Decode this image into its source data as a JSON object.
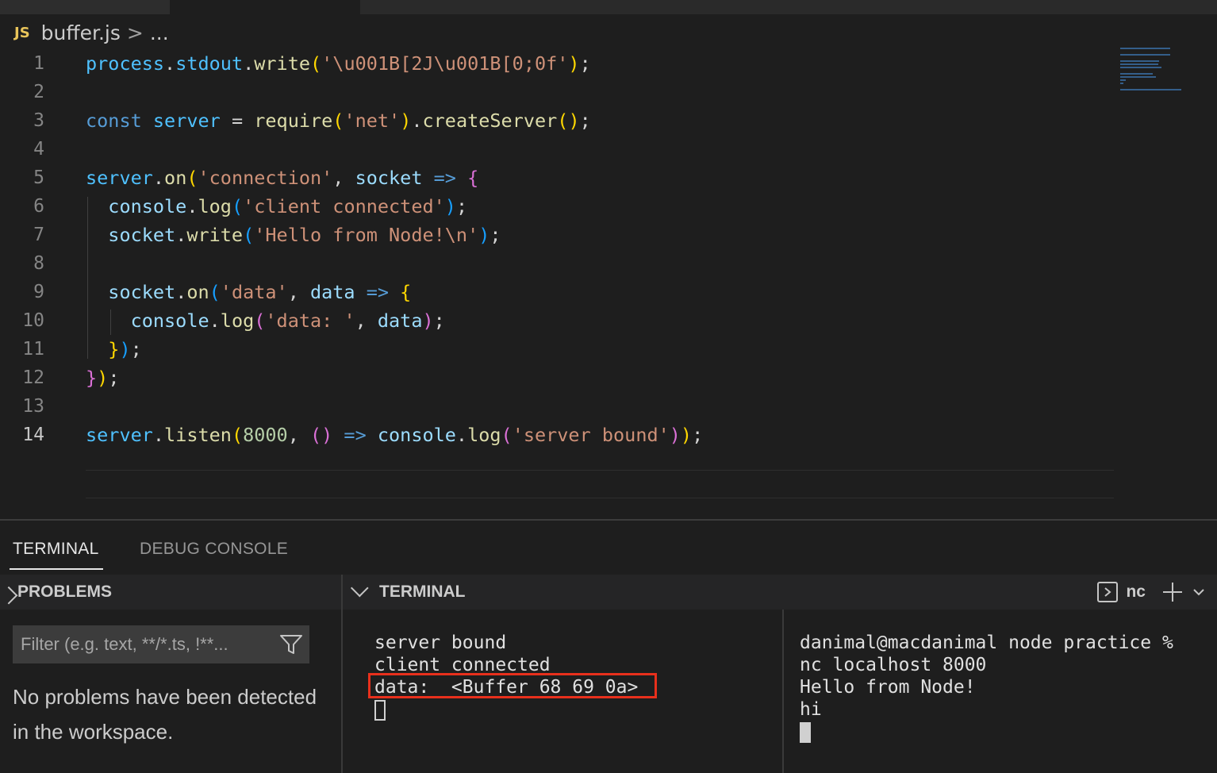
{
  "breadcrumb": {
    "file_icon": "JS",
    "filename": "buffer.js",
    "separator": ">",
    "more": "..."
  },
  "editor": {
    "active_line": "14",
    "lines": [
      {
        "n": "1",
        "tokens": [
          [
            "process",
            "t-var"
          ],
          [
            ".",
            "t-p"
          ],
          [
            "stdout",
            "t-var"
          ],
          [
            ".",
            "t-p"
          ],
          [
            "write",
            "t-fn"
          ],
          [
            "(",
            "t-b1"
          ],
          [
            "'\\u001B[2J\\u001B[0;0f'",
            "t-str"
          ],
          [
            ")",
            "t-b1"
          ],
          [
            ";",
            "t-p"
          ]
        ]
      },
      {
        "n": "2",
        "tokens": []
      },
      {
        "n": "3",
        "tokens": [
          [
            "const",
            "t-kw"
          ],
          [
            " ",
            "t-p"
          ],
          [
            "server",
            "t-var"
          ],
          [
            " = ",
            "t-p"
          ],
          [
            "require",
            "t-fn"
          ],
          [
            "(",
            "t-b1"
          ],
          [
            "'net'",
            "t-str"
          ],
          [
            ")",
            "t-b1"
          ],
          [
            ".",
            "t-p"
          ],
          [
            "createServer",
            "t-fn"
          ],
          [
            "()",
            "t-b1"
          ],
          [
            ";",
            "t-p"
          ]
        ]
      },
      {
        "n": "4",
        "tokens": []
      },
      {
        "n": "5",
        "tokens": [
          [
            "server",
            "t-var"
          ],
          [
            ".",
            "t-p"
          ],
          [
            "on",
            "t-fn"
          ],
          [
            "(",
            "t-b1"
          ],
          [
            "'connection'",
            "t-str"
          ],
          [
            ", ",
            "t-p"
          ],
          [
            "socket",
            "t-prop"
          ],
          [
            " => ",
            "t-kw"
          ],
          [
            "{",
            "t-b2"
          ]
        ]
      },
      {
        "n": "6",
        "tokens": [
          [
            "  ",
            "t-p"
          ],
          [
            "console",
            "t-prop"
          ],
          [
            ".",
            "t-p"
          ],
          [
            "log",
            "t-fn"
          ],
          [
            "(",
            "t-b3"
          ],
          [
            "'client connected'",
            "t-str"
          ],
          [
            ")",
            "t-b3"
          ],
          [
            ";",
            "t-p"
          ]
        ]
      },
      {
        "n": "7",
        "tokens": [
          [
            "  ",
            "t-p"
          ],
          [
            "socket",
            "t-prop"
          ],
          [
            ".",
            "t-p"
          ],
          [
            "write",
            "t-fn"
          ],
          [
            "(",
            "t-b3"
          ],
          [
            "'Hello from Node!\\n'",
            "t-str"
          ],
          [
            ")",
            "t-b3"
          ],
          [
            ";",
            "t-p"
          ]
        ]
      },
      {
        "n": "8",
        "tokens": []
      },
      {
        "n": "9",
        "tokens": [
          [
            "  ",
            "t-p"
          ],
          [
            "socket",
            "t-prop"
          ],
          [
            ".",
            "t-p"
          ],
          [
            "on",
            "t-fn"
          ],
          [
            "(",
            "t-b3"
          ],
          [
            "'data'",
            "t-str"
          ],
          [
            ", ",
            "t-p"
          ],
          [
            "data",
            "t-prop"
          ],
          [
            " => ",
            "t-kw"
          ],
          [
            "{",
            "t-b1"
          ]
        ]
      },
      {
        "n": "10",
        "tokens": [
          [
            "    ",
            "t-p"
          ],
          [
            "console",
            "t-prop"
          ],
          [
            ".",
            "t-p"
          ],
          [
            "log",
            "t-fn"
          ],
          [
            "(",
            "t-b2"
          ],
          [
            "'data: '",
            "t-str"
          ],
          [
            ", ",
            "t-p"
          ],
          [
            "data",
            "t-prop"
          ],
          [
            ")",
            "t-b2"
          ],
          [
            ";",
            "t-p"
          ]
        ]
      },
      {
        "n": "11",
        "tokens": [
          [
            "  ",
            "t-p"
          ],
          [
            "}",
            "t-b1"
          ],
          [
            ")",
            "t-b3"
          ],
          [
            ";",
            "t-p"
          ]
        ]
      },
      {
        "n": "12",
        "tokens": [
          [
            "}",
            "t-b2"
          ],
          [
            ")",
            "t-b1"
          ],
          [
            ";",
            "t-p"
          ]
        ]
      },
      {
        "n": "13",
        "tokens": []
      },
      {
        "n": "14",
        "tokens": [
          [
            "server",
            "t-var"
          ],
          [
            ".",
            "t-p"
          ],
          [
            "listen",
            "t-fn"
          ],
          [
            "(",
            "t-b1"
          ],
          [
            "8000",
            "t-num"
          ],
          [
            ", ",
            "t-p"
          ],
          [
            "()",
            "t-b2"
          ],
          [
            " => ",
            "t-kw"
          ],
          [
            "console",
            "t-prop"
          ],
          [
            ".",
            "t-p"
          ],
          [
            "log",
            "t-fn"
          ],
          [
            "(",
            "t-b2"
          ],
          [
            "'server bound'",
            "t-str"
          ],
          [
            ")",
            "t-b2"
          ],
          [
            ")",
            "t-b1"
          ],
          [
            ";",
            "t-p"
          ]
        ]
      }
    ]
  },
  "panel": {
    "tabs": [
      {
        "label": "TERMINAL",
        "active": true
      },
      {
        "label": "DEBUG CONSOLE",
        "active": false
      }
    ]
  },
  "problems": {
    "header": "PROBLEMS",
    "filter_placeholder": "Filter (e.g. text, **/*.ts, !**...",
    "message": "No problems have been detected in the workspace."
  },
  "terminal": {
    "header": "TERMINAL",
    "name": "nc",
    "left_lines": [
      "server bound",
      "client connected",
      "data:  <Buffer 68 69 0a>"
    ],
    "right_lines": [
      "danimal@macdanimal node practice %",
      "nc localhost 8000",
      "Hello from Node!",
      "hi"
    ]
  },
  "colors": {
    "highlight_border": "#e8301c",
    "background": "#1e1e1e",
    "string": "#ce9178",
    "variable": "#4fc1ff"
  },
  "icons": [
    "js-file-icon",
    "filter-icon",
    "chevron-down-icon",
    "chevron-right-icon",
    "terminal-icon",
    "plus-icon"
  ]
}
